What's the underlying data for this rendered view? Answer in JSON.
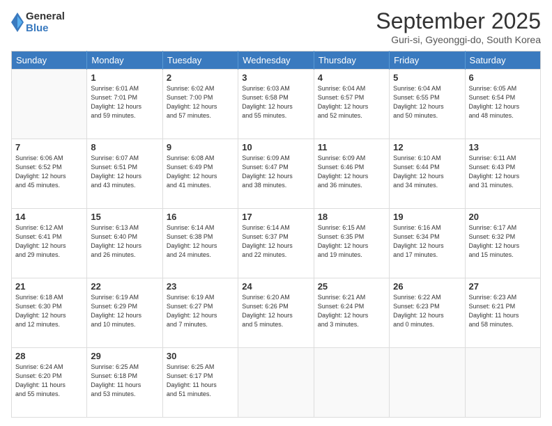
{
  "logo": {
    "general": "General",
    "blue": "Blue"
  },
  "header": {
    "month": "September 2025",
    "location": "Guri-si, Gyeonggi-do, South Korea"
  },
  "days_of_week": [
    "Sunday",
    "Monday",
    "Tuesday",
    "Wednesday",
    "Thursday",
    "Friday",
    "Saturday"
  ],
  "weeks": [
    [
      {
        "day": "",
        "info": ""
      },
      {
        "day": "1",
        "info": "Sunrise: 6:01 AM\nSunset: 7:01 PM\nDaylight: 12 hours\nand 59 minutes."
      },
      {
        "day": "2",
        "info": "Sunrise: 6:02 AM\nSunset: 7:00 PM\nDaylight: 12 hours\nand 57 minutes."
      },
      {
        "day": "3",
        "info": "Sunrise: 6:03 AM\nSunset: 6:58 PM\nDaylight: 12 hours\nand 55 minutes."
      },
      {
        "day": "4",
        "info": "Sunrise: 6:04 AM\nSunset: 6:57 PM\nDaylight: 12 hours\nand 52 minutes."
      },
      {
        "day": "5",
        "info": "Sunrise: 6:04 AM\nSunset: 6:55 PM\nDaylight: 12 hours\nand 50 minutes."
      },
      {
        "day": "6",
        "info": "Sunrise: 6:05 AM\nSunset: 6:54 PM\nDaylight: 12 hours\nand 48 minutes."
      }
    ],
    [
      {
        "day": "7",
        "info": "Sunrise: 6:06 AM\nSunset: 6:52 PM\nDaylight: 12 hours\nand 45 minutes."
      },
      {
        "day": "8",
        "info": "Sunrise: 6:07 AM\nSunset: 6:51 PM\nDaylight: 12 hours\nand 43 minutes."
      },
      {
        "day": "9",
        "info": "Sunrise: 6:08 AM\nSunset: 6:49 PM\nDaylight: 12 hours\nand 41 minutes."
      },
      {
        "day": "10",
        "info": "Sunrise: 6:09 AM\nSunset: 6:47 PM\nDaylight: 12 hours\nand 38 minutes."
      },
      {
        "day": "11",
        "info": "Sunrise: 6:09 AM\nSunset: 6:46 PM\nDaylight: 12 hours\nand 36 minutes."
      },
      {
        "day": "12",
        "info": "Sunrise: 6:10 AM\nSunset: 6:44 PM\nDaylight: 12 hours\nand 34 minutes."
      },
      {
        "day": "13",
        "info": "Sunrise: 6:11 AM\nSunset: 6:43 PM\nDaylight: 12 hours\nand 31 minutes."
      }
    ],
    [
      {
        "day": "14",
        "info": "Sunrise: 6:12 AM\nSunset: 6:41 PM\nDaylight: 12 hours\nand 29 minutes."
      },
      {
        "day": "15",
        "info": "Sunrise: 6:13 AM\nSunset: 6:40 PM\nDaylight: 12 hours\nand 26 minutes."
      },
      {
        "day": "16",
        "info": "Sunrise: 6:14 AM\nSunset: 6:38 PM\nDaylight: 12 hours\nand 24 minutes."
      },
      {
        "day": "17",
        "info": "Sunrise: 6:14 AM\nSunset: 6:37 PM\nDaylight: 12 hours\nand 22 minutes."
      },
      {
        "day": "18",
        "info": "Sunrise: 6:15 AM\nSunset: 6:35 PM\nDaylight: 12 hours\nand 19 minutes."
      },
      {
        "day": "19",
        "info": "Sunrise: 6:16 AM\nSunset: 6:34 PM\nDaylight: 12 hours\nand 17 minutes."
      },
      {
        "day": "20",
        "info": "Sunrise: 6:17 AM\nSunset: 6:32 PM\nDaylight: 12 hours\nand 15 minutes."
      }
    ],
    [
      {
        "day": "21",
        "info": "Sunrise: 6:18 AM\nSunset: 6:30 PM\nDaylight: 12 hours\nand 12 minutes."
      },
      {
        "day": "22",
        "info": "Sunrise: 6:19 AM\nSunset: 6:29 PM\nDaylight: 12 hours\nand 10 minutes."
      },
      {
        "day": "23",
        "info": "Sunrise: 6:19 AM\nSunset: 6:27 PM\nDaylight: 12 hours\nand 7 minutes."
      },
      {
        "day": "24",
        "info": "Sunrise: 6:20 AM\nSunset: 6:26 PM\nDaylight: 12 hours\nand 5 minutes."
      },
      {
        "day": "25",
        "info": "Sunrise: 6:21 AM\nSunset: 6:24 PM\nDaylight: 12 hours\nand 3 minutes."
      },
      {
        "day": "26",
        "info": "Sunrise: 6:22 AM\nSunset: 6:23 PM\nDaylight: 12 hours\nand 0 minutes."
      },
      {
        "day": "27",
        "info": "Sunrise: 6:23 AM\nSunset: 6:21 PM\nDaylight: 11 hours\nand 58 minutes."
      }
    ],
    [
      {
        "day": "28",
        "info": "Sunrise: 6:24 AM\nSunset: 6:20 PM\nDaylight: 11 hours\nand 55 minutes."
      },
      {
        "day": "29",
        "info": "Sunrise: 6:25 AM\nSunset: 6:18 PM\nDaylight: 11 hours\nand 53 minutes."
      },
      {
        "day": "30",
        "info": "Sunrise: 6:25 AM\nSunset: 6:17 PM\nDaylight: 11 hours\nand 51 minutes."
      },
      {
        "day": "",
        "info": ""
      },
      {
        "day": "",
        "info": ""
      },
      {
        "day": "",
        "info": ""
      },
      {
        "day": "",
        "info": ""
      }
    ]
  ]
}
